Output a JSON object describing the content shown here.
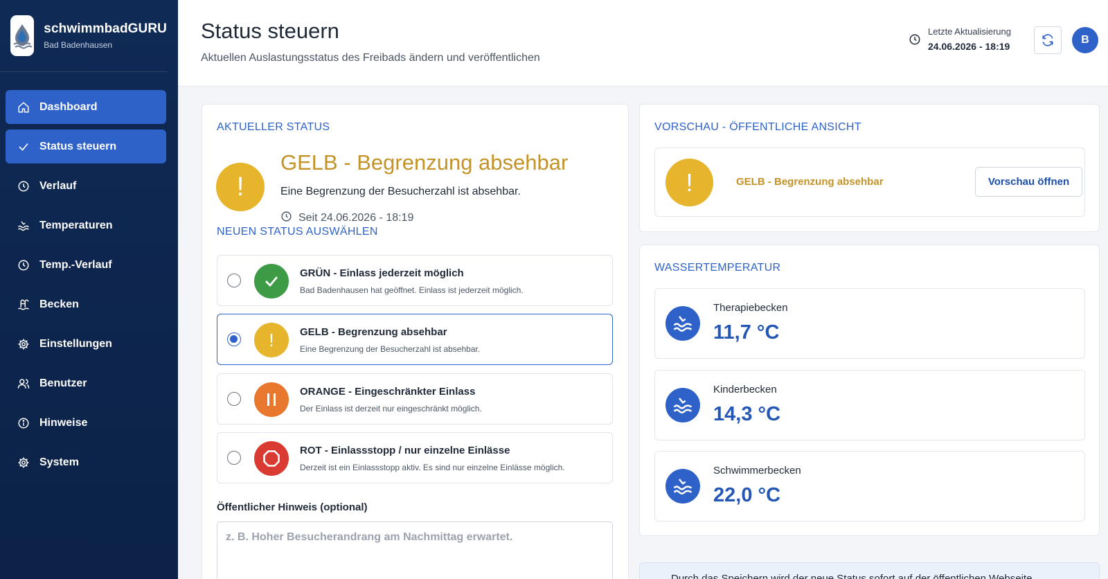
{
  "brand": {
    "name": "schwimmbadGURU",
    "location": "Bad Badenhausen"
  },
  "sidebar": {
    "items": [
      {
        "label": "Dashboard",
        "icon": "home-icon",
        "active": true
      },
      {
        "label": "Status steuern",
        "icon": "check-icon",
        "active": true
      },
      {
        "label": "Verlauf",
        "icon": "clock-icon"
      },
      {
        "label": "Temperaturen",
        "icon": "water-icon"
      },
      {
        "label": "Temp.-Verlauf",
        "icon": "clock-icon"
      },
      {
        "label": "Becken",
        "icon": "pool-ladder-icon"
      },
      {
        "label": "Einstellungen",
        "icon": "gear-icon"
      },
      {
        "label": "Benutzer",
        "icon": "users-icon"
      },
      {
        "label": "Hinweise",
        "icon": "info-icon"
      },
      {
        "label": "System",
        "icon": "gear-icon"
      }
    ]
  },
  "header": {
    "title": "Status steuern",
    "subtitle": "Aktuellen Auslastungsstatus des Freibads ändern und veröffentlichen",
    "update_label": "Letzte Aktualisierung",
    "update_value": "24.06.2026 - 18:19",
    "avatar_initial": "B"
  },
  "current": {
    "section_title": "AKTUELLER STATUS",
    "symbol": "!",
    "title": "GELB - Begrenzung absehbar",
    "description": "Eine Begrenzung der Besucherzahl ist absehbar.",
    "since": "Seit 24.06.2026 - 18:19"
  },
  "select": {
    "section_title": "NEUEN STATUS AUSWÄHLEN",
    "options": [
      {
        "title": "GRÜN - Einlass jederzeit möglich",
        "description": "Bad Badenhausen hat geöffnet. Einlass ist jederzeit möglich.",
        "color": "#3d9b45",
        "icon": "check-icon",
        "selected": false
      },
      {
        "title": "GELB - Begrenzung absehbar",
        "description": "Eine Begrenzung der Besucherzahl ist absehbar.",
        "color": "#e6b52c",
        "icon": "exclamation-icon",
        "symbol": "!",
        "selected": true
      },
      {
        "title": "ORANGE - Eingeschränkter Einlass",
        "description": "Der Einlass ist derzeit nur eingeschränkt möglich.",
        "color": "#e8782e",
        "icon": "pause-icon",
        "selected": false
      },
      {
        "title": "ROT - Einlassstopp / nur einzelne Einlässe",
        "description": "Derzeit ist ein Einlassstopp aktiv. Es sind nur einzelne Einlässe möglich.",
        "color": "#d93a32",
        "icon": "stop-icon",
        "selected": false
      }
    ]
  },
  "hint": {
    "label": "Öffentlicher Hinweis (optional)",
    "placeholder": "z. B. Hoher Besucherandrang am Nachmittag erwartet.",
    "value": ""
  },
  "preview": {
    "section_title": "VORSCHAU - ÖFFENTLICHE ANSICHT",
    "symbol": "!",
    "label": "GELB - Begrenzung absehbar",
    "button": "Vorschau öffnen"
  },
  "water": {
    "section_title": "WASSERTEMPERATUR",
    "pools": [
      {
        "name": "Therapiebecken",
        "temp": "11,7 °C"
      },
      {
        "name": "Kinderbecken",
        "temp": "14,3 °C"
      },
      {
        "name": "Schwimmerbecken",
        "temp": "22,0 °C"
      }
    ]
  },
  "info": {
    "text": "Durch das Speichern wird der neue Status sofort auf der öffentlichen Webseite"
  },
  "colors": {
    "accent": "#2e62c9",
    "sidebar": "#0f2a55",
    "yellow": "#e6b52c",
    "yellow_text": "#c49327"
  }
}
